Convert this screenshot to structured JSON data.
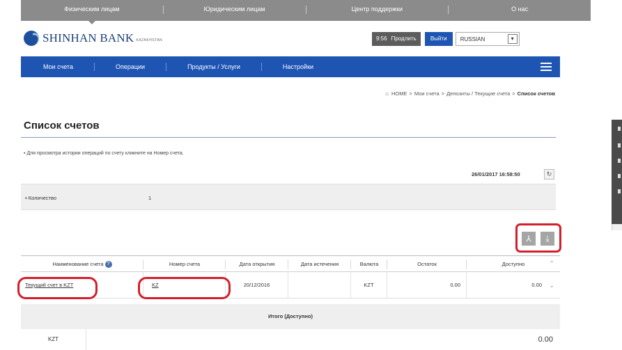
{
  "topbar": {
    "items": [
      "Физическим лицам",
      "Юридическим лицам",
      "Центр поддержки",
      "О нас"
    ]
  },
  "brand": {
    "name": "SHINHAN BANK",
    "sub": "KAZAKHSTAN"
  },
  "session": {
    "time": "9:56",
    "extend_label": "Продлить",
    "logout_label": "Выйти",
    "language": "RUSSIAN"
  },
  "mainnav": {
    "items": [
      "Мои счета",
      "Операции",
      "Продукты / Услуги",
      "Настройки"
    ]
  },
  "breadcrumb": {
    "items": [
      "HOME",
      "Мои счета",
      "Депозиты / Текущие счета",
      "Список счетов"
    ]
  },
  "page": {
    "title": "Список счетов",
    "note": "Для просмотра истории операций по счету кликните на Номер счета.",
    "timestamp": "26/01/2017 16:58:50"
  },
  "count": {
    "label": "Количество",
    "value": "1"
  },
  "table": {
    "headers": [
      "Наименование счета",
      "Номер счета",
      "Дата открытия",
      "Дата истечения",
      "Валюта",
      "Остаток",
      "Доступно"
    ],
    "rows": [
      {
        "name": "Текущий счет в KZT",
        "number": "KZ",
        "opened": "20/12/2016",
        "expires": "",
        "currency": "KZT",
        "balance": "0.00",
        "available": "0.00"
      }
    ]
  },
  "totals": {
    "header": "Итого (Доступно)",
    "currency": "KZT",
    "amount": "0.00"
  },
  "colors": {
    "nav_blue": "#1e55b3",
    "topbar_gray": "#8b8b8b",
    "highlight_red": "#d21f2c"
  },
  "icons": [
    "pdf-icon",
    "download-icon",
    "refresh-icon",
    "home-icon",
    "info-icon",
    "menu-icon",
    "dropdown-arrow-icon"
  ]
}
